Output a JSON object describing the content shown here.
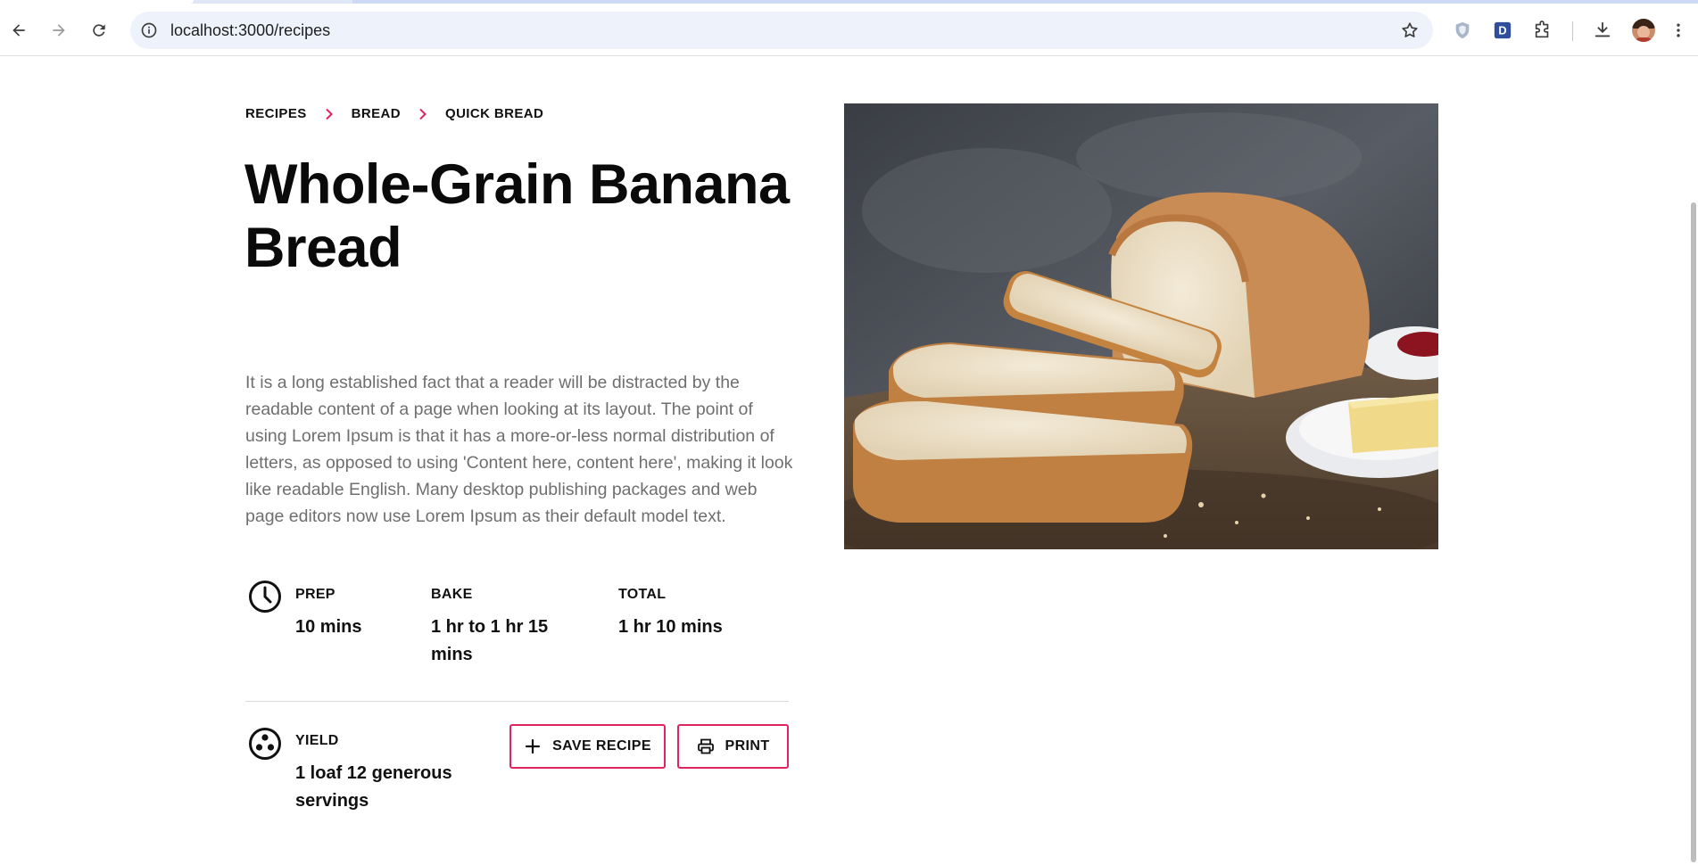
{
  "browser": {
    "url": "localhost:3000/recipes"
  },
  "breadcrumb": [
    "RECIPES",
    "BREAD",
    "QUICK BREAD"
  ],
  "recipe": {
    "title": "Whole-Grain Banana Bread",
    "description": "It is a long established fact that a reader will be distracted by the readable content of a page when looking at its layout. The point of using Lorem Ipsum is that it has a more-or-less normal distribution of letters, as opposed to using 'Content here, content here', making it look like readable English. Many desktop publishing packages and web page editors now use Lorem Ipsum as their default model text.",
    "times": [
      {
        "label": "PREP",
        "value": "10 mins"
      },
      {
        "label": "BAKE",
        "value": "1 hr to 1 hr 15 mins"
      },
      {
        "label": "TOTAL",
        "value": "1 hr 10 mins"
      }
    ],
    "yield": {
      "label": "YIELD",
      "value": "1 loaf 12 generous servings"
    }
  },
  "actions": {
    "save_label": "SAVE RECIPE",
    "print_label": "PRINT"
  },
  "colors": {
    "accent": "#e0245e",
    "text": "#111111",
    "muted": "#6f6f6f"
  }
}
